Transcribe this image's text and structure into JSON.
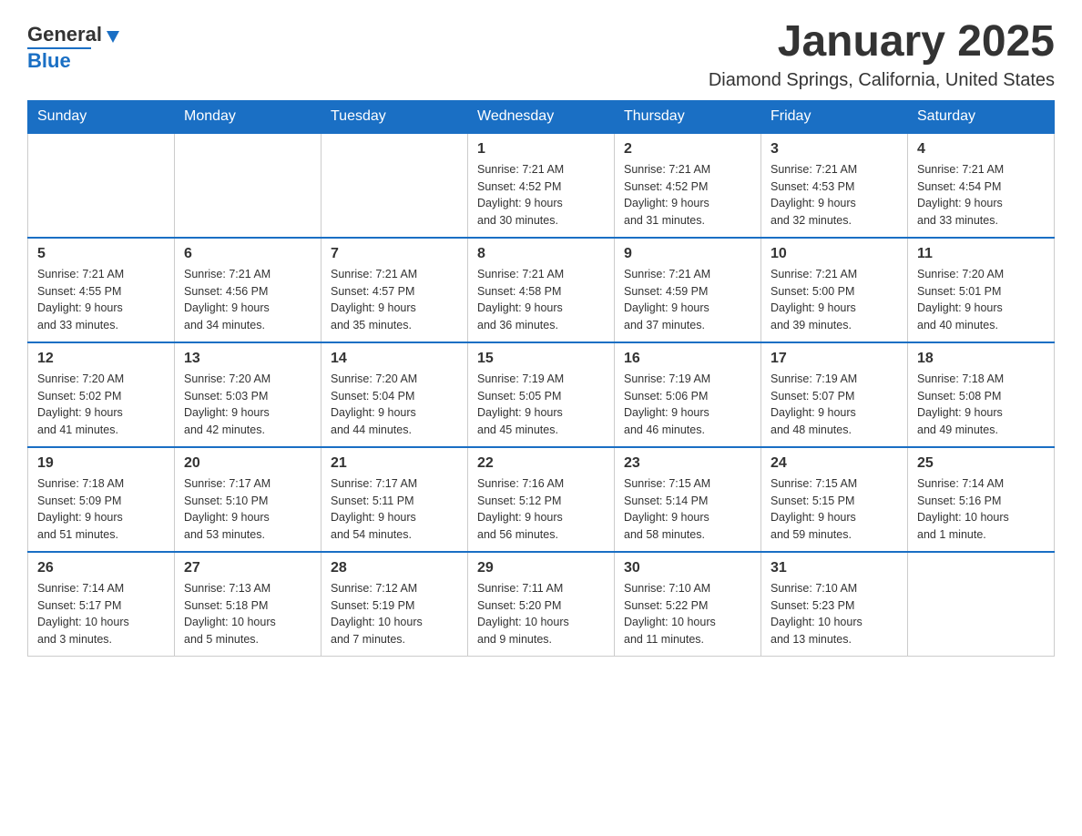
{
  "header": {
    "logo": {
      "general": "General",
      "blue": "Blue"
    },
    "title": "January 2025",
    "location": "Diamond Springs, California, United States"
  },
  "calendar": {
    "days_of_week": [
      "Sunday",
      "Monday",
      "Tuesday",
      "Wednesday",
      "Thursday",
      "Friday",
      "Saturday"
    ],
    "weeks": [
      [
        {
          "day": "",
          "info": ""
        },
        {
          "day": "",
          "info": ""
        },
        {
          "day": "",
          "info": ""
        },
        {
          "day": "1",
          "info": "Sunrise: 7:21 AM\nSunset: 4:52 PM\nDaylight: 9 hours\nand 30 minutes."
        },
        {
          "day": "2",
          "info": "Sunrise: 7:21 AM\nSunset: 4:52 PM\nDaylight: 9 hours\nand 31 minutes."
        },
        {
          "day": "3",
          "info": "Sunrise: 7:21 AM\nSunset: 4:53 PM\nDaylight: 9 hours\nand 32 minutes."
        },
        {
          "day": "4",
          "info": "Sunrise: 7:21 AM\nSunset: 4:54 PM\nDaylight: 9 hours\nand 33 minutes."
        }
      ],
      [
        {
          "day": "5",
          "info": "Sunrise: 7:21 AM\nSunset: 4:55 PM\nDaylight: 9 hours\nand 33 minutes."
        },
        {
          "day": "6",
          "info": "Sunrise: 7:21 AM\nSunset: 4:56 PM\nDaylight: 9 hours\nand 34 minutes."
        },
        {
          "day": "7",
          "info": "Sunrise: 7:21 AM\nSunset: 4:57 PM\nDaylight: 9 hours\nand 35 minutes."
        },
        {
          "day": "8",
          "info": "Sunrise: 7:21 AM\nSunset: 4:58 PM\nDaylight: 9 hours\nand 36 minutes."
        },
        {
          "day": "9",
          "info": "Sunrise: 7:21 AM\nSunset: 4:59 PM\nDaylight: 9 hours\nand 37 minutes."
        },
        {
          "day": "10",
          "info": "Sunrise: 7:21 AM\nSunset: 5:00 PM\nDaylight: 9 hours\nand 39 minutes."
        },
        {
          "day": "11",
          "info": "Sunrise: 7:20 AM\nSunset: 5:01 PM\nDaylight: 9 hours\nand 40 minutes."
        }
      ],
      [
        {
          "day": "12",
          "info": "Sunrise: 7:20 AM\nSunset: 5:02 PM\nDaylight: 9 hours\nand 41 minutes."
        },
        {
          "day": "13",
          "info": "Sunrise: 7:20 AM\nSunset: 5:03 PM\nDaylight: 9 hours\nand 42 minutes."
        },
        {
          "day": "14",
          "info": "Sunrise: 7:20 AM\nSunset: 5:04 PM\nDaylight: 9 hours\nand 44 minutes."
        },
        {
          "day": "15",
          "info": "Sunrise: 7:19 AM\nSunset: 5:05 PM\nDaylight: 9 hours\nand 45 minutes."
        },
        {
          "day": "16",
          "info": "Sunrise: 7:19 AM\nSunset: 5:06 PM\nDaylight: 9 hours\nand 46 minutes."
        },
        {
          "day": "17",
          "info": "Sunrise: 7:19 AM\nSunset: 5:07 PM\nDaylight: 9 hours\nand 48 minutes."
        },
        {
          "day": "18",
          "info": "Sunrise: 7:18 AM\nSunset: 5:08 PM\nDaylight: 9 hours\nand 49 minutes."
        }
      ],
      [
        {
          "day": "19",
          "info": "Sunrise: 7:18 AM\nSunset: 5:09 PM\nDaylight: 9 hours\nand 51 minutes."
        },
        {
          "day": "20",
          "info": "Sunrise: 7:17 AM\nSunset: 5:10 PM\nDaylight: 9 hours\nand 53 minutes."
        },
        {
          "day": "21",
          "info": "Sunrise: 7:17 AM\nSunset: 5:11 PM\nDaylight: 9 hours\nand 54 minutes."
        },
        {
          "day": "22",
          "info": "Sunrise: 7:16 AM\nSunset: 5:12 PM\nDaylight: 9 hours\nand 56 minutes."
        },
        {
          "day": "23",
          "info": "Sunrise: 7:15 AM\nSunset: 5:14 PM\nDaylight: 9 hours\nand 58 minutes."
        },
        {
          "day": "24",
          "info": "Sunrise: 7:15 AM\nSunset: 5:15 PM\nDaylight: 9 hours\nand 59 minutes."
        },
        {
          "day": "25",
          "info": "Sunrise: 7:14 AM\nSunset: 5:16 PM\nDaylight: 10 hours\nand 1 minute."
        }
      ],
      [
        {
          "day": "26",
          "info": "Sunrise: 7:14 AM\nSunset: 5:17 PM\nDaylight: 10 hours\nand 3 minutes."
        },
        {
          "day": "27",
          "info": "Sunrise: 7:13 AM\nSunset: 5:18 PM\nDaylight: 10 hours\nand 5 minutes."
        },
        {
          "day": "28",
          "info": "Sunrise: 7:12 AM\nSunset: 5:19 PM\nDaylight: 10 hours\nand 7 minutes."
        },
        {
          "day": "29",
          "info": "Sunrise: 7:11 AM\nSunset: 5:20 PM\nDaylight: 10 hours\nand 9 minutes."
        },
        {
          "day": "30",
          "info": "Sunrise: 7:10 AM\nSunset: 5:22 PM\nDaylight: 10 hours\nand 11 minutes."
        },
        {
          "day": "31",
          "info": "Sunrise: 7:10 AM\nSunset: 5:23 PM\nDaylight: 10 hours\nand 13 minutes."
        },
        {
          "day": "",
          "info": ""
        }
      ]
    ]
  }
}
